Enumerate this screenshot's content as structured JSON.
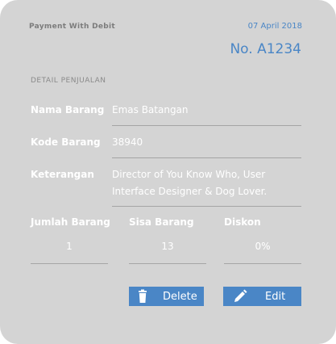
{
  "header": {
    "title": "Payment With Debit",
    "date": "07 April 2018",
    "invoice_no": "No. A1234"
  },
  "section_title": "DETAIL PENJUALAN",
  "fields": {
    "nama_barang": {
      "label": "Nama Barang",
      "value": "Emas Batangan"
    },
    "kode_barang": {
      "label": "Kode Barang",
      "value": "38940"
    },
    "keterangan": {
      "label": "Keterangan",
      "value": "Director of You Know Who, User Interface Designer & Dog Lover."
    }
  },
  "summary": {
    "jumlah_barang": {
      "label": "Jumlah Barang",
      "value": "1"
    },
    "sisa_barang": {
      "label": "Sisa Barang",
      "value": "13"
    },
    "diskon": {
      "label": "Diskon",
      "value": "0%"
    }
  },
  "actions": {
    "delete_label": "Delete",
    "edit_label": "Edit",
    "delete_icon": "trash-icon",
    "edit_icon": "pencil-icon"
  },
  "colors": {
    "card_background": "#d4d4d4",
    "accent": "#4a86c6",
    "text_light": "#ffffff",
    "muted": "#7c7c7c"
  }
}
